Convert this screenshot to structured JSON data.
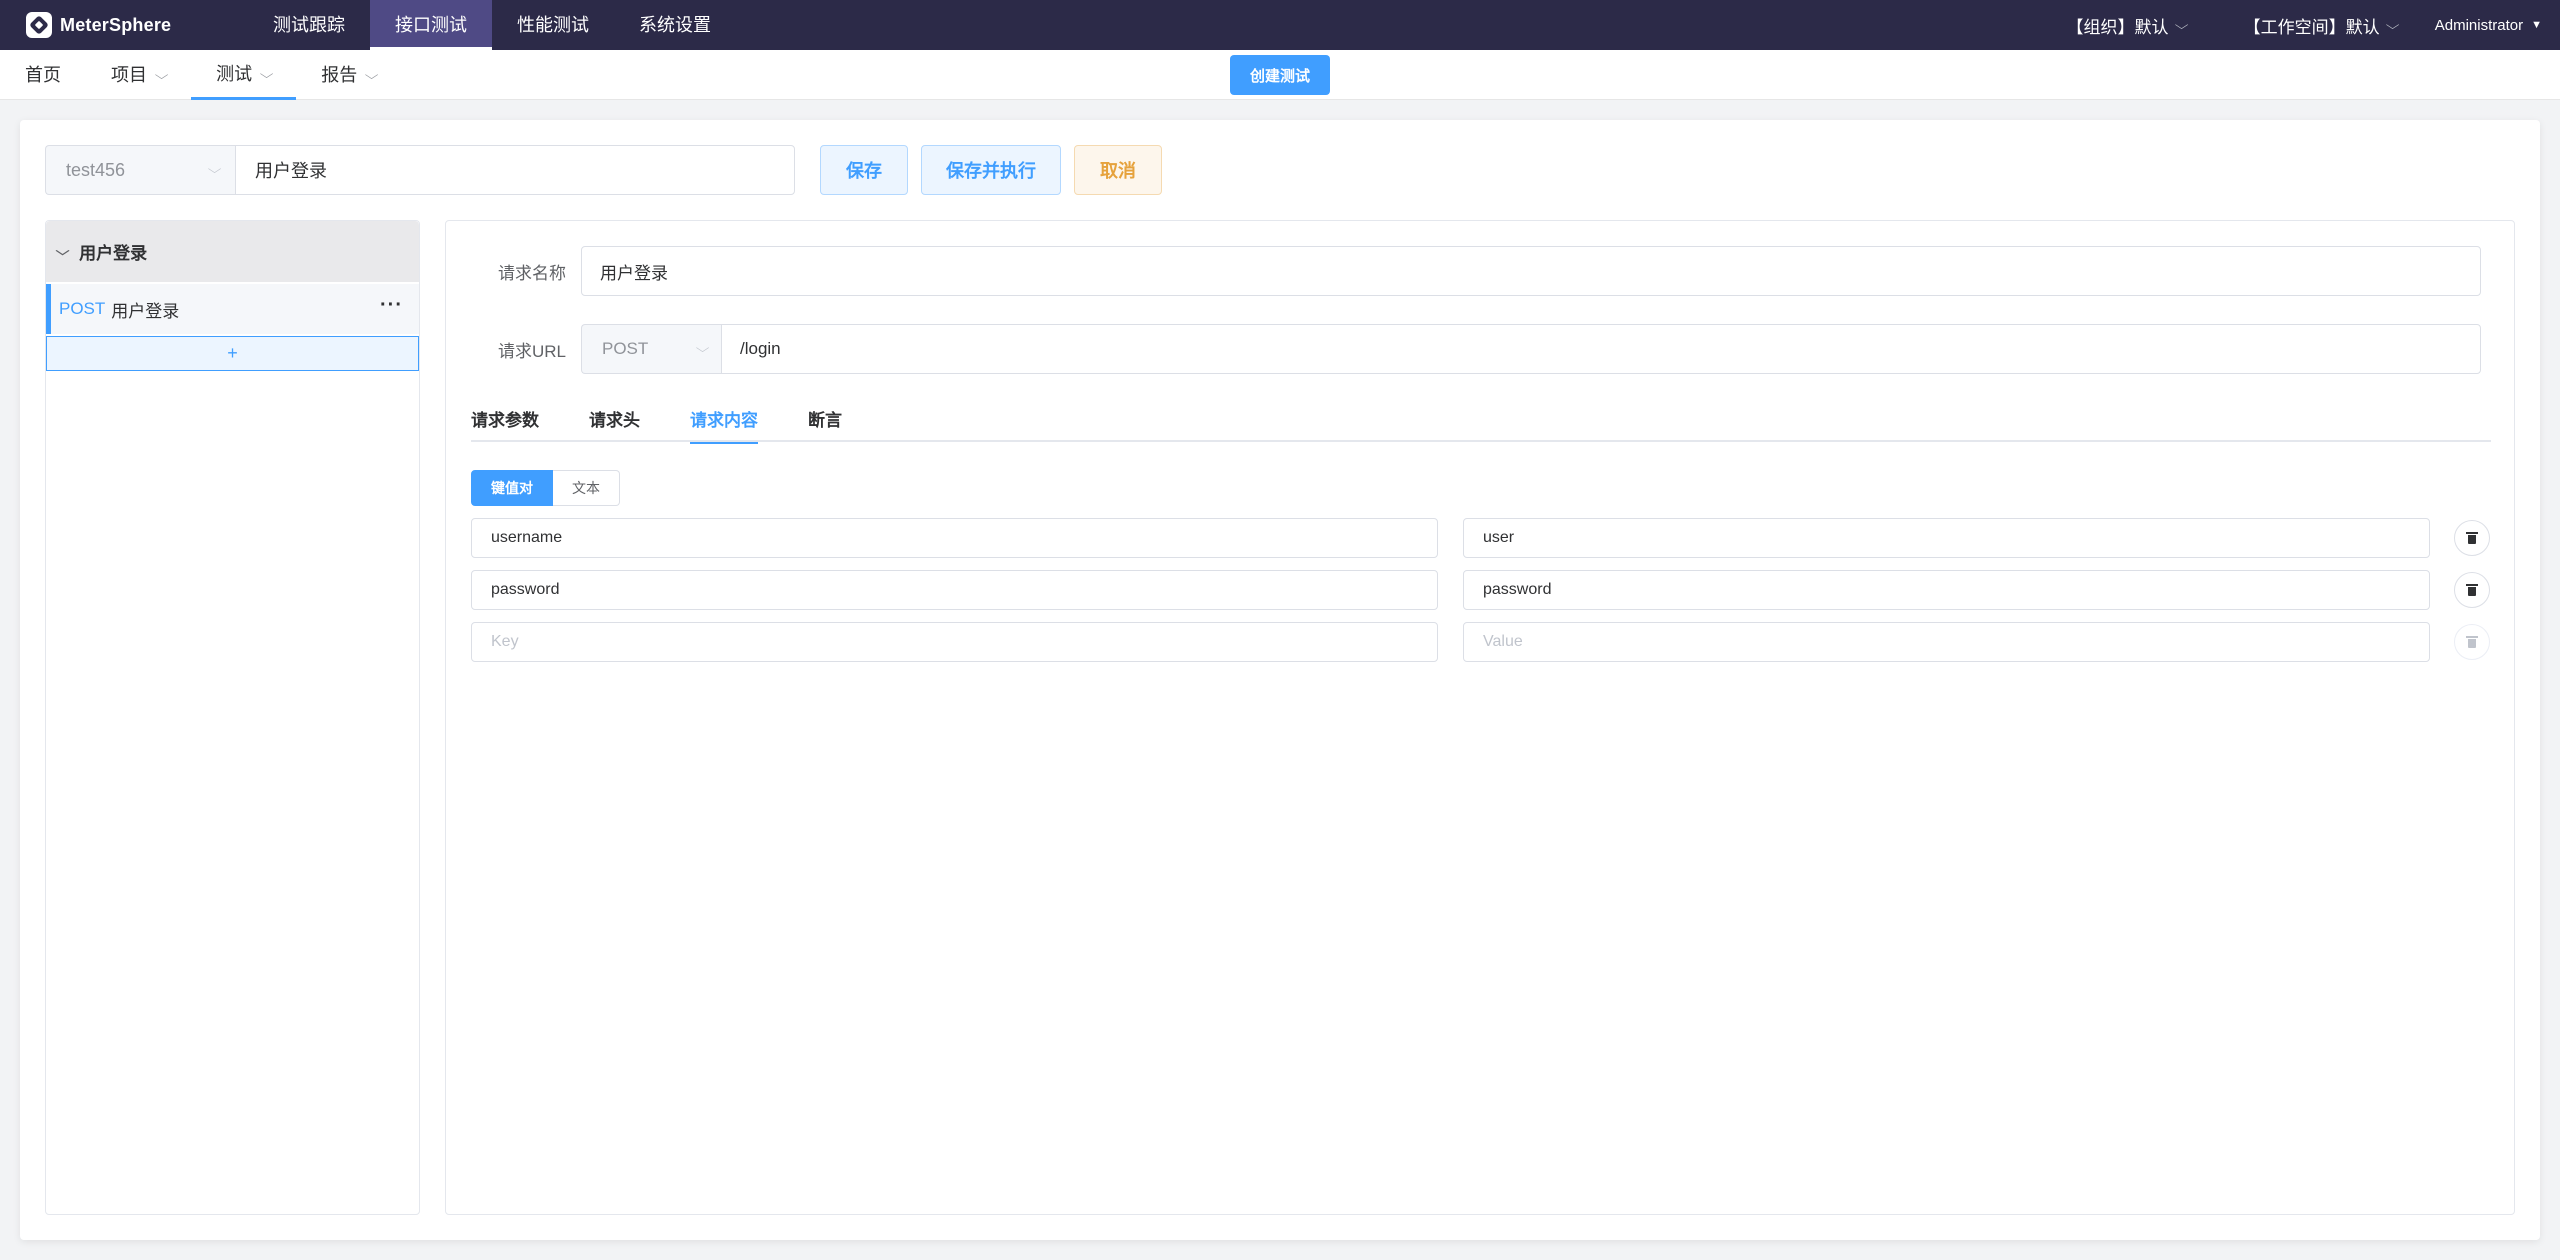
{
  "app": {
    "name": "MeterSphere"
  },
  "topnav": {
    "items": [
      {
        "label": "测试跟踪"
      },
      {
        "label": "接口测试"
      },
      {
        "label": "性能测试"
      },
      {
        "label": "系统设置"
      }
    ],
    "active_index": 1
  },
  "user": {
    "org_label": "【组织】默认",
    "workspace_label": "【工作空间】默认",
    "name": "Administrator"
  },
  "subnav": {
    "items": [
      {
        "label": "首页"
      },
      {
        "label": "项目"
      },
      {
        "label": "测试"
      },
      {
        "label": "报告"
      }
    ],
    "active_index": 2,
    "create_button": "创建测试"
  },
  "editor": {
    "project": "test456",
    "test_name": "用户登录",
    "save_label": "保存",
    "save_run_label": "保存并执行",
    "cancel_label": "取消"
  },
  "scenario_list": {
    "group_name": "用户登录",
    "requests": [
      {
        "method": "POST",
        "name": "用户登录"
      }
    ],
    "add_label": "+"
  },
  "request": {
    "name_label": "请求名称",
    "name": "用户登录",
    "url_label": "请求URL",
    "method": "POST",
    "url": "/login",
    "tabs": [
      {
        "label": "请求参数"
      },
      {
        "label": "请求头"
      },
      {
        "label": "请求内容"
      },
      {
        "label": "断言"
      }
    ],
    "active_tab_index": 2,
    "body_modes": [
      {
        "label": "键值对"
      },
      {
        "label": "文本"
      }
    ],
    "active_body_mode": 0,
    "body": [
      {
        "key": "username",
        "value": "user"
      },
      {
        "key": "password",
        "value": "password"
      }
    ],
    "key_placeholder": "Key",
    "value_placeholder": "Value"
  },
  "colors": {
    "header_bg": "#2c2a48",
    "primary": "#409eff",
    "warning": "#e6a23c"
  }
}
